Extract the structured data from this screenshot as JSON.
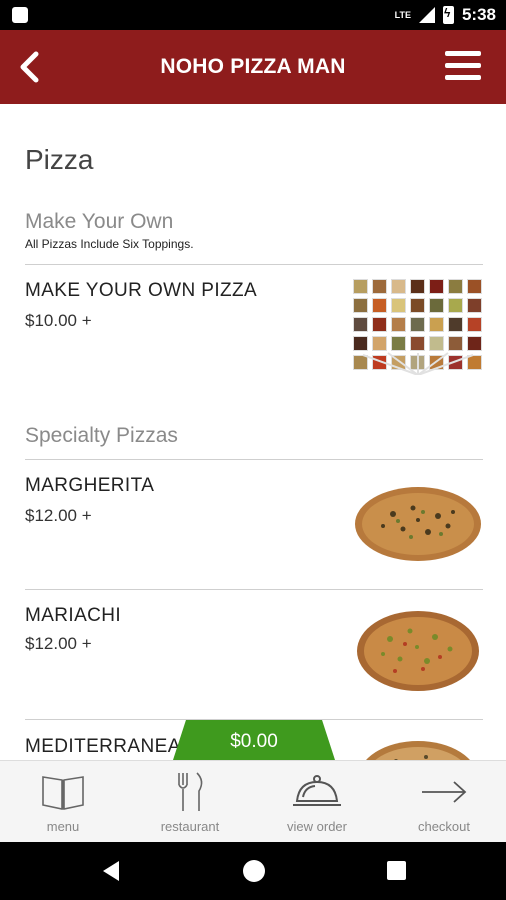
{
  "status": {
    "time": "5:38",
    "network": "LTE"
  },
  "appbar": {
    "title": "NOHO PIZZA MAN",
    "back_icon": "back-chevron-icon",
    "menu_icon": "hamburger-menu-icon"
  },
  "page": {
    "heading": "Pizza"
  },
  "sections": [
    {
      "title": "Make Your Own",
      "subtitle": "All Pizzas Include Six Toppings."
    },
    {
      "title": "Specialty Pizzas"
    }
  ],
  "items": [
    {
      "name": "MAKE YOUR OWN PIZZA",
      "price": "$10.00 +"
    },
    {
      "name": "MARGHERITA",
      "price": "$12.00 +"
    },
    {
      "name": "MARIACHI",
      "price": "$12.00 +"
    },
    {
      "name": "MEDITERRANEA",
      "price": ""
    }
  ],
  "order": {
    "total": "$0.00",
    "accent": "#3f9a1e"
  },
  "nav": [
    {
      "label": "menu",
      "icon": "book-icon"
    },
    {
      "label": "restaurant",
      "icon": "fork-knife-icon"
    },
    {
      "label": "view order",
      "icon": "cloche-icon"
    },
    {
      "label": "checkout",
      "icon": "arrow-right-icon"
    }
  ],
  "colors": {
    "brand": "#8e1c1c",
    "total_bar": "#3f9a1e"
  },
  "spice_colors": [
    "#b79e60",
    "#9d6a3b",
    "#d8b98a",
    "#5b2f19",
    "#7c1e16",
    "#8b7c40",
    "#9b5126",
    "#8c6f3f",
    "#c65e24",
    "#d9c47a",
    "#7b4b27",
    "#6b6a3b",
    "#a8a94d",
    "#7e3f2a",
    "#5f4b3f",
    "#8f2e1a",
    "#b47e4a",
    "#6d6b4e",
    "#caa050",
    "#4f3b2b",
    "#b64226",
    "#4a2a1e",
    "#d2a46a",
    "#7a7c45",
    "#8a4a2e",
    "#c1bb8d",
    "#8d5c39",
    "#6e2519",
    "#a8884f",
    "#be3b20",
    "#c49e63",
    "#b1a47e",
    "#b97a3b",
    "#9c322d",
    "#c07b31"
  ]
}
